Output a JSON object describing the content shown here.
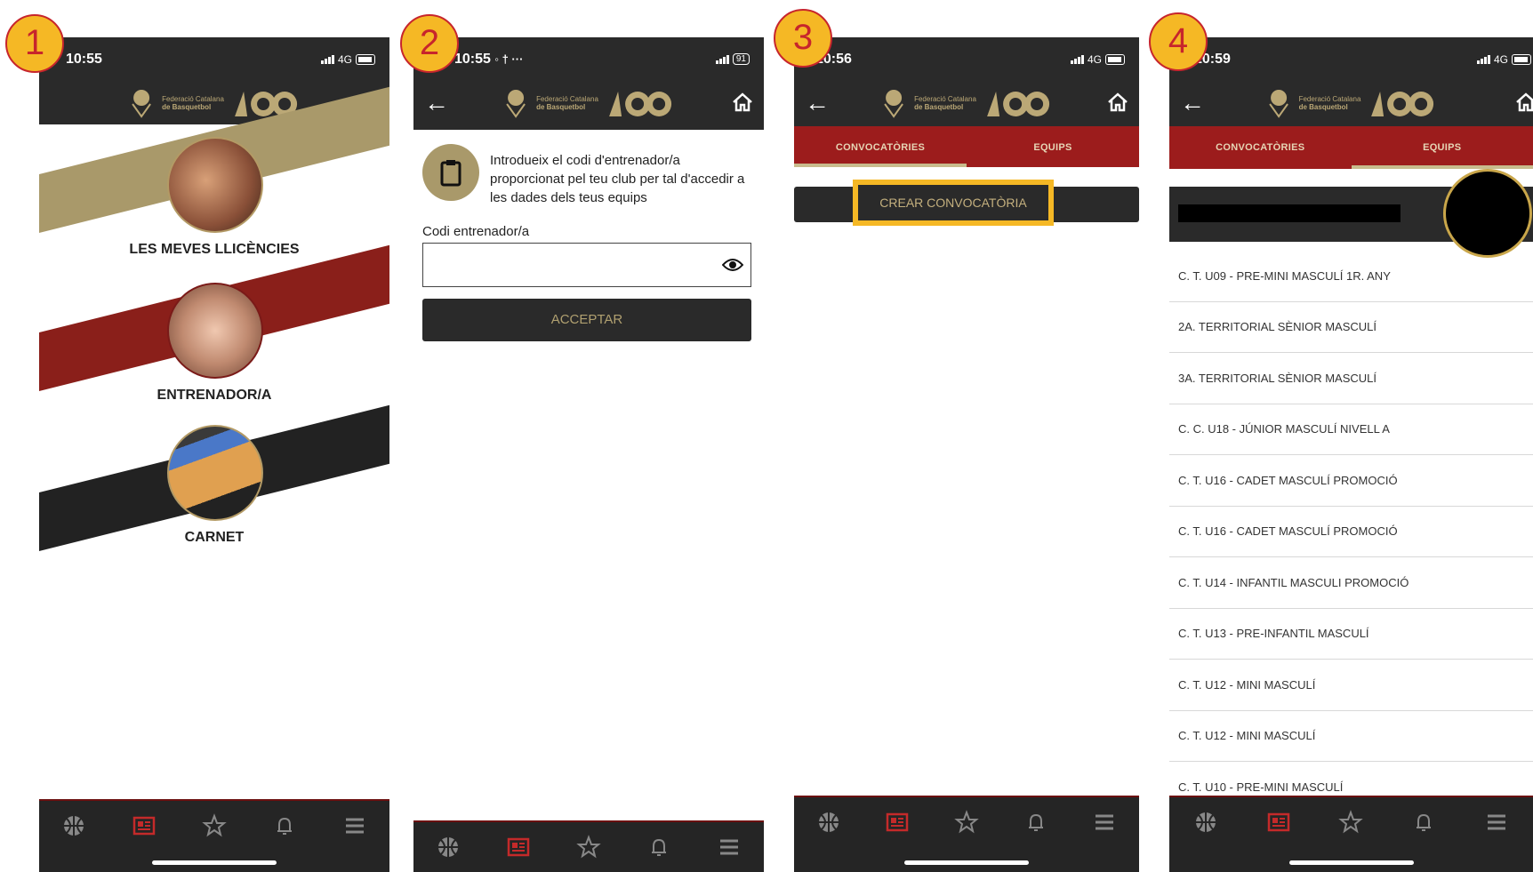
{
  "badges": [
    "1",
    "2",
    "3",
    "4"
  ],
  "status": {
    "s1_time": "10:55",
    "s2_time": "10:55",
    "s3_time": "10:56",
    "s4_time": "10:59",
    "network": "4G",
    "battery_s2": "91",
    "s2_extra": "◦ † ···"
  },
  "logo": {
    "fed_line1": "Federació Catalana",
    "fed_line2": "de Basquetbol"
  },
  "screen1": {
    "items": [
      {
        "label": "LES MEVES LLICÈNCIES"
      },
      {
        "label": "ENTRENADOR/A"
      },
      {
        "label": "CARNET"
      }
    ]
  },
  "screen2": {
    "instruction": "Introdueix el codi d'entrenador/a proporcionat pel teu club per tal d'accedir a les dades dels teus equips",
    "field_label": "Codi entrenador/a",
    "field_value": "",
    "accept_label": "ACCEPTAR"
  },
  "tabs": {
    "convocatories": "CONVOCATÒRIES",
    "equips": "EQUIPS"
  },
  "screen3": {
    "create_label": "CREAR CONVOCATÒRIA"
  },
  "screen4": {
    "teams": [
      "C. T. U09 - PRE-MINI MASCULÍ 1R. ANY",
      "2A. TERRITORIAL SÈNIOR MASCULÍ",
      "3A. TERRITORIAL SÈNIOR MASCULÍ",
      "C. C. U18 - JÚNIOR MASCULÍ NIVELL A",
      "C. T. U16 - CADET MASCULÍ PROMOCIÓ",
      "C. T. U16 - CADET MASCULÍ PROMOCIÓ",
      "C. T. U14 - INFANTIL MASCULI PROMOCIÓ",
      "C. T. U13 - PRE-INFANTIL MASCULÍ",
      "C. T. U12 - MINI MASCULÍ",
      "C. T. U12 - MINI MASCULÍ",
      "C. T. U10 - PRE-MINI MASCULÍ"
    ]
  },
  "colors": {
    "dark": "#2a2a2a",
    "gold": "#bba876",
    "red": "#9c1c1c",
    "highlight": "#f5b825"
  },
  "icons": [
    "basketball-icon",
    "id-card-icon",
    "star-icon",
    "bell-icon",
    "menu-icon",
    "back-arrow-icon",
    "home-icon",
    "clipboard-icon",
    "eye-icon"
  ]
}
